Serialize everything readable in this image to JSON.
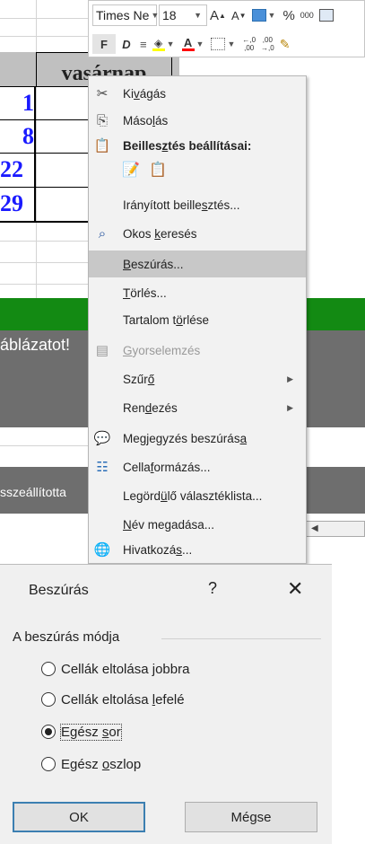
{
  "sheet": {
    "header_cell": "vasárnap",
    "row_numbers": [
      "1",
      "8",
      "22",
      "29"
    ],
    "truncated_text_1": "áblázatot!",
    "truncated_text_2": "sszeállította"
  },
  "mini_toolbar": {
    "font_name": "Times Ne",
    "font_size": "18",
    "grow_font": "A",
    "shrink_font": "A",
    "percent": "%",
    "thousands": "000",
    "bold": "F",
    "italic": "D",
    "font_color_letter": "A",
    "increase_decimal": "←,0 ,00",
    "decrease_decimal": ",00 →,0",
    "fill_color": "#ffff00",
    "font_color": "#ff0000"
  },
  "context_menu": {
    "cut": {
      "pre": "Ki",
      "ul": "v",
      "post": "ágás"
    },
    "copy": {
      "pre": "Máso",
      "ul": "l",
      "post": "ás"
    },
    "paste_options": {
      "pre": "Beilles",
      "ul": "z",
      "post": "tés beállításai:"
    },
    "paste_special": {
      "pre": "Irányított beille",
      "ul": "s",
      "post": "ztés..."
    },
    "smart_lookup": {
      "pre": "Okos ",
      "ul": "k",
      "post": "eresés"
    },
    "insert": {
      "pre": "",
      "ul": "B",
      "post": "eszúrás..."
    },
    "delete": {
      "pre": "",
      "ul": "T",
      "post": "örlés..."
    },
    "clear_contents": {
      "pre": "Tartalom t",
      "ul": "ö",
      "post": "rlése"
    },
    "quick_analysis": {
      "pre": "",
      "ul": "G",
      "post": "yorselemzés"
    },
    "filter": {
      "pre": "Szűr",
      "ul": "ő",
      "post": ""
    },
    "sort": {
      "pre": "Ren",
      "ul": "d",
      "post": "ezés"
    },
    "insert_comment": {
      "pre": "Megjegyzés beszúrás",
      "ul": "a",
      "post": ""
    },
    "format_cells": {
      "pre": "Cella",
      "ul": "f",
      "post": "ormázás..."
    },
    "pick_from_list": {
      "pre": "Legörd",
      "ul": "ü",
      "post": "lő választéklista..."
    },
    "define_name": {
      "pre": "",
      "ul": "N",
      "post": "év megadása..."
    },
    "hyperlink": {
      "pre": "Hivatkozá",
      "ul": "s",
      "post": "..."
    }
  },
  "dialog": {
    "title": "Beszúrás",
    "help": "?",
    "close": "✕",
    "group_label": "A beszúrás módja",
    "options": [
      {
        "pre": "Cellák eltolása ",
        "ul": "j",
        "post": "obbra",
        "selected": false
      },
      {
        "pre": "Cellák eltolása ",
        "ul": "l",
        "post": "efelé",
        "selected": false
      },
      {
        "pre": "Egész ",
        "ul": "s",
        "post": "or",
        "selected": true
      },
      {
        "pre": "Egész ",
        "ul": "o",
        "post": "szlop",
        "selected": false
      }
    ],
    "ok": "OK",
    "cancel": "Mégse"
  }
}
